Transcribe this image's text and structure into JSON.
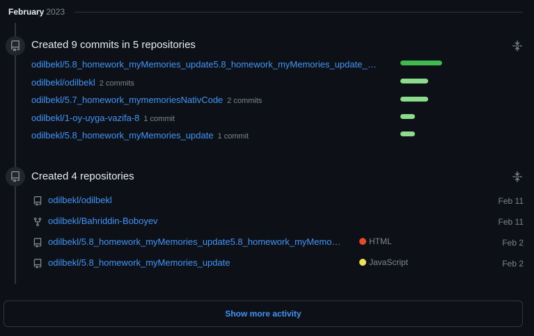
{
  "month": {
    "name": "February",
    "year": "2023"
  },
  "commits_event": {
    "title": "Created 9 commits in 5 repositories",
    "icon": "repo-push-icon",
    "rows": [
      {
        "repo": "odilbekl/5.8_homework_myMemories_update5.8_homework_myMemories_update_…",
        "count": "",
        "bar_fraction": 1.0
      },
      {
        "repo": "odilbekl/odilbekl",
        "count": "2 commits",
        "bar_fraction": 0.67
      },
      {
        "repo": "odilbekl/5.7_homework_mymemoriesNativCode",
        "count": "2 commits",
        "bar_fraction": 0.67
      },
      {
        "repo": "odilbekl/1-oy-uyga-vazifa-8",
        "count": "1 commit",
        "bar_fraction": 0.35
      },
      {
        "repo": "odilbekl/5.8_homework_myMemories_update",
        "count": "1 commit",
        "bar_fraction": 0.35
      }
    ]
  },
  "repos_event": {
    "title": "Created 4 repositories",
    "icon": "repo-icon",
    "rows": [
      {
        "repo": "odilbekl/odilbekl",
        "icon": "repo-icon",
        "language": "",
        "lang_color": "",
        "date": "Feb 11"
      },
      {
        "repo": "odilbekl/Bahriddin-Boboyev",
        "icon": "repo-forked-icon",
        "language": "",
        "lang_color": "",
        "date": "Feb 11"
      },
      {
        "repo": "odilbekl/5.8_homework_myMemories_update5.8_homework_myMemo…",
        "icon": "repo-icon",
        "language": "HTML",
        "lang_color": "#e34c26",
        "date": "Feb 2"
      },
      {
        "repo": "odilbekl/5.8_homework_myMemories_update",
        "icon": "repo-icon",
        "language": "JavaScript",
        "lang_color": "#f1e05a",
        "date": "Feb 2"
      }
    ]
  },
  "show_more_label": "Show more activity",
  "colors": {
    "bar_primary": "#3fb950",
    "bar_secondary": "#8ddb8c",
    "link": "#4493f8"
  }
}
